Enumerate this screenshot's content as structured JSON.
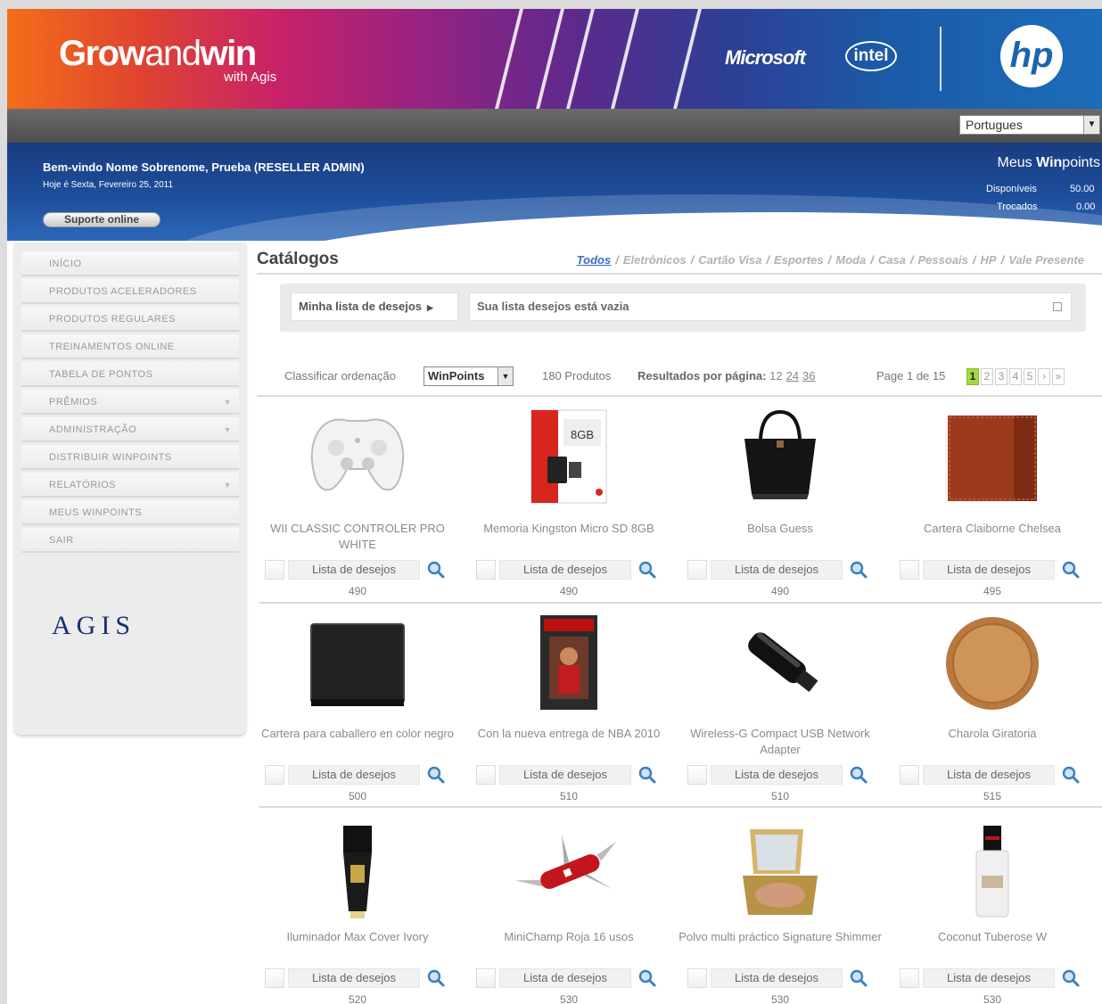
{
  "header": {
    "brand_grow": "Grow",
    "brand_and": "and",
    "brand_win": "win",
    "brand_sub": "with Agis",
    "partner_microsoft": "Microsoft",
    "partner_intel": "intel",
    "partner_hp": "hp"
  },
  "language": {
    "selected": "Portugues"
  },
  "welcome": {
    "greeting": "Bem-vindo Nome Sobrenome, Prueba  (RESELLER ADMIN)",
    "date": "Hoje é Sexta, Fevereiro 25, 2011",
    "support_label": "Suporte online"
  },
  "winpoints": {
    "title_prefix": "Meus ",
    "title_bold": "Win",
    "title_suffix": "points",
    "available_label": "Disponíveis",
    "available_value": "50.00",
    "exchanged_label": "Trocados",
    "exchanged_value": "0.00"
  },
  "sidebar": {
    "items": [
      {
        "label": "INÍCIO",
        "submenu": false
      },
      {
        "label": "PRODUTOS ACELERADORES",
        "submenu": false
      },
      {
        "label": "PRODUTOS REGULARES",
        "submenu": false
      },
      {
        "label": "TREINAMENTOS ONLINE",
        "submenu": false
      },
      {
        "label": "TABELA DE PONTOS",
        "submenu": false
      },
      {
        "label": "PRÊMIOS",
        "submenu": true
      },
      {
        "label": "ADMINISTRAÇÃO",
        "submenu": true
      },
      {
        "label": "DISTRIBUIR WINPOINTS",
        "submenu": false
      },
      {
        "label": "RELATÓRIOS",
        "submenu": true
      },
      {
        "label": "MEUS WINPOINTS",
        "submenu": false
      },
      {
        "label": "SAIR",
        "submenu": false
      }
    ],
    "footer_logo": "AGIS"
  },
  "catalog": {
    "title": "Catálogos",
    "nav": [
      "Todos",
      "Eletrônicos",
      "Cartão Visa",
      "Esportes",
      "Moda",
      "Casa",
      "Pessoais",
      "HP",
      "Vale Presente"
    ],
    "nav_active": 0
  },
  "wishlist": {
    "button_label": "Minha lista de desejos",
    "status": "Sua lista desejos está vazia"
  },
  "toolbar": {
    "sort_label": "Classificar ordenação",
    "sort_value": "WinPoints",
    "product_count": "180 Produtos",
    "per_page_label": "Resultados por página:",
    "per_page_options": [
      "12",
      "24",
      "36"
    ],
    "page_info": "Page 1 de 15",
    "pages": [
      "1",
      "2",
      "3",
      "4",
      "5",
      "›",
      "»"
    ],
    "current_page": 0
  },
  "product_wish_label": "Lista de desejos",
  "products": [
    {
      "name": "WII CLASSIC CONTROLER PRO WHITE",
      "price": "490",
      "image": "controller"
    },
    {
      "name": "Memoria Kingston Micro SD 8GB",
      "price": "490",
      "image": "sdcard"
    },
    {
      "name": "Bolsa Guess",
      "price": "490",
      "image": "bag"
    },
    {
      "name": "Cartera Claiborne Chelsea",
      "price": "495",
      "image": "wallet-brown"
    },
    {
      "name": "Cartera para caballero en color negro",
      "price": "500",
      "image": "wallet-black"
    },
    {
      "name": "Con la nueva entrega de NBA 2010",
      "price": "510",
      "image": "game"
    },
    {
      "name": "Wireless-G Compact USB Network Adapter",
      "price": "510",
      "image": "usb"
    },
    {
      "name": "Charola Giratoria",
      "price": "515",
      "image": "tray"
    },
    {
      "name": "Iluminador Max Cover Ivory",
      "price": "520",
      "image": "tube"
    },
    {
      "name": "MiniChamp Roja 16 usos",
      "price": "530",
      "image": "knife"
    },
    {
      "name": "Polvo multi práctico Signature Shimmer",
      "price": "530",
      "image": "compact"
    },
    {
      "name": "Coconut Tuberose W",
      "price": "530",
      "image": "perfume"
    }
  ]
}
